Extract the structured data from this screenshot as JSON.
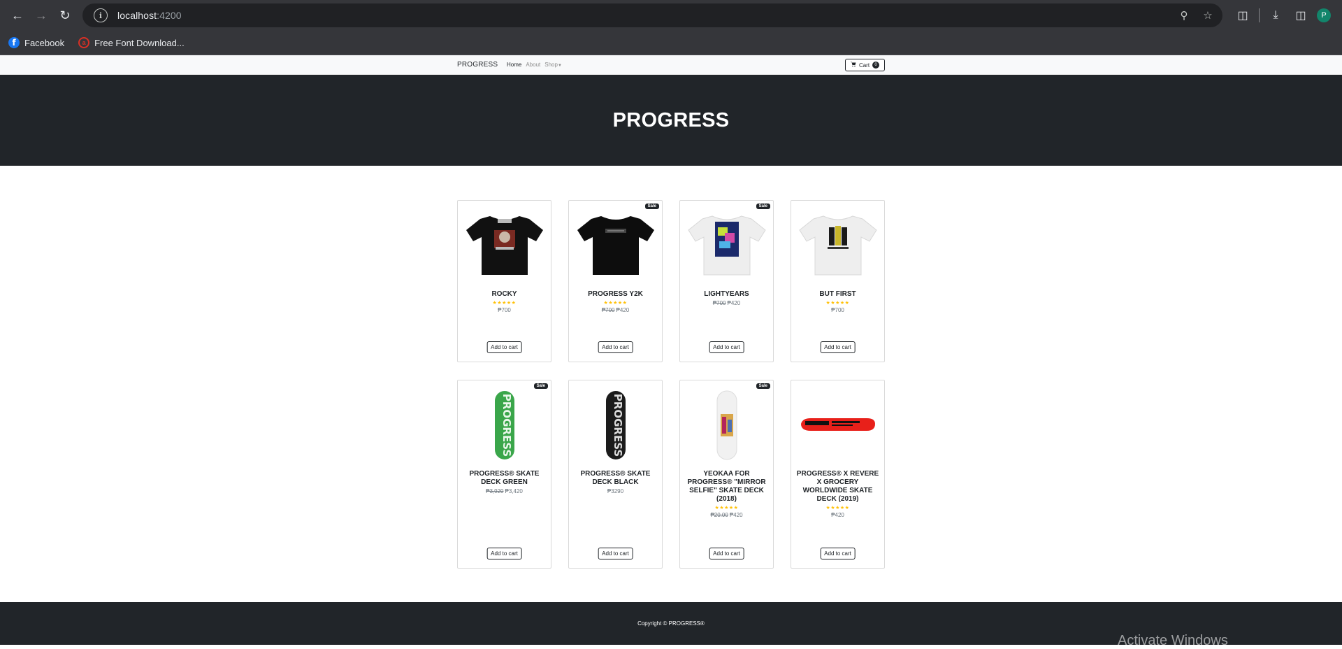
{
  "browser": {
    "url_host": "localhost",
    "url_port": ":4200",
    "profile_initial": "P",
    "bookmarks": [
      {
        "label": "Facebook",
        "icon": "facebook-icon"
      },
      {
        "label": "Free Font Download...",
        "icon": "fontfree-icon"
      }
    ]
  },
  "navbar": {
    "brand": "PROGRESS",
    "links": [
      "Home",
      "About",
      "Shop"
    ],
    "active_link": "Home",
    "cart_label": "Cart",
    "cart_count": "0"
  },
  "hero": {
    "title": "PROGRESS"
  },
  "product_rows": [
    [
      {
        "name": "ROCKY",
        "sale": false,
        "rating": 5,
        "old_price": "",
        "price": "₱700",
        "image": "tshirt-black-photo",
        "button": "Add to cart"
      },
      {
        "name": "PROGRESS Y2K",
        "sale": true,
        "rating": 5,
        "old_price": "₱700",
        "price": "₱420",
        "image": "tshirt-black-logo",
        "button": "Add to cart"
      },
      {
        "name": "LIGHTYEARS",
        "sale": true,
        "rating": 0,
        "old_price": "₱700",
        "price": "₱420",
        "image": "tshirt-white-poster",
        "button": "Add to cart"
      },
      {
        "name": "BUT FIRST",
        "sale": false,
        "rating": 5,
        "old_price": "",
        "price": "₱700",
        "image": "tshirt-white-figures",
        "button": "Add to cart"
      }
    ],
    [
      {
        "name": "PROGRESS® SKATE DECK GREEN",
        "sale": true,
        "rating": 0,
        "old_price": "₱3,920",
        "price": "₱3,420",
        "image": "deck-green",
        "button": "Add to cart"
      },
      {
        "name": "PROGRESS® SKATE DECK BLACK",
        "sale": false,
        "rating": 0,
        "old_price": "",
        "price": "₱3290",
        "image": "deck-black",
        "button": "Add to cart"
      },
      {
        "name": "YEOKAA FOR PROGRESS® \"MIRROR SELFIE\" SKATE DECK (2018)",
        "sale": true,
        "rating": 5,
        "old_price": "₱20.00",
        "price": "₱420",
        "image": "deck-white-art",
        "button": "Add to cart"
      },
      {
        "name": "PROGRESS® X REVERE X GROCERY WORLDWIDE SKATE DECK (2019)",
        "sale": false,
        "rating": 5,
        "old_price": "",
        "price": "₱420",
        "image": "deck-red-side",
        "button": "Add to cart"
      }
    ]
  ],
  "footer": {
    "copyright": "Copyright © PROGRESS®"
  },
  "overlay": {
    "watermark": "Activate Windows"
  }
}
